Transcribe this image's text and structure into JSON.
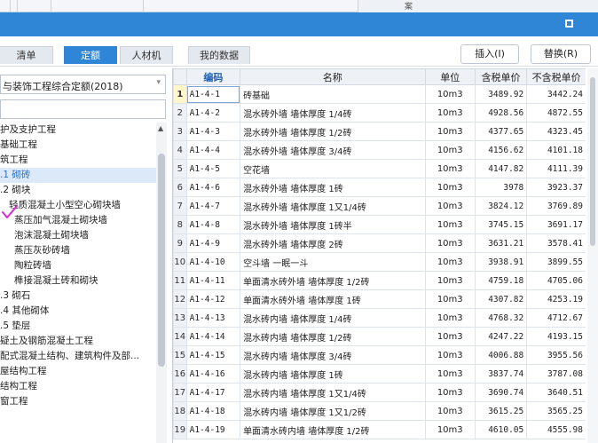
{
  "top_strip": {
    "glyph": "案"
  },
  "title_bar": {
    "maximize_label": "maximize-icon"
  },
  "tabs": [
    {
      "label": "清单",
      "active": false
    },
    {
      "label": "定额",
      "active": true
    },
    {
      "label": "人材机",
      "active": false
    },
    {
      "label": "我的数据",
      "active": false
    }
  ],
  "buttons": {
    "insert": "插入(I)",
    "replace": "替换(R)"
  },
  "left_panel": {
    "norm_select_value": "与装饰工程综合定额(2018)",
    "search_value": "",
    "tree": [
      {
        "label": "护及支护工程",
        "selected": false
      },
      {
        "label": "基础工程",
        "selected": false
      },
      {
        "label": "筑工程",
        "selected": false
      },
      {
        "label": ".1 砌砖",
        "selected": true
      },
      {
        "label": ".2 砌块",
        "selected": false
      },
      {
        "label": "轻质混凝土小型空心砌块墙",
        "selected": false
      },
      {
        "label": "蒸压加气混凝土砌块墙",
        "selected": false
      },
      {
        "label": "泡沫混凝土砌块墙",
        "selected": false
      },
      {
        "label": "蒸压灰砂砖墙",
        "selected": false
      },
      {
        "label": "陶粒砖墙",
        "selected": false
      },
      {
        "label": "榫接混凝土砖和砌块",
        "selected": false
      },
      {
        "label": ".3 砌石",
        "selected": false
      },
      {
        "label": ".4 其他砌体",
        "selected": false
      },
      {
        "label": ".5 垫层",
        "selected": false
      },
      {
        "label": "疑土及钢筋混凝土工程",
        "selected": false
      },
      {
        "label": "配式混凝土结构、建筑构件及部...",
        "selected": false
      },
      {
        "label": "屋结构工程",
        "selected": false
      },
      {
        "label": "结构工程",
        "selected": false
      },
      {
        "label": "窗工程",
        "selected": false
      }
    ]
  },
  "grid": {
    "headers": {
      "code": "编码",
      "name": "名称",
      "unit": "单位",
      "price_tax": "含税单价",
      "price_notax": "不含税单价"
    },
    "rows": [
      {
        "n": "1",
        "code": "A1-4-1",
        "name": "砖基础",
        "unit": "10m3",
        "price_tax": "3489.92",
        "price_notax": "3442.24"
      },
      {
        "n": "2",
        "code": "A1-4-2",
        "name": "混水砖外墙 墙体厚度 1/4砖",
        "unit": "10m3",
        "price_tax": "4928.56",
        "price_notax": "4872.55"
      },
      {
        "n": "3",
        "code": "A1-4-3",
        "name": "混水砖外墙 墙体厚度 1/2砖",
        "unit": "10m3",
        "price_tax": "4377.65",
        "price_notax": "4323.45"
      },
      {
        "n": "4",
        "code": "A1-4-4",
        "name": "混水砖外墙 墙体厚度 3/4砖",
        "unit": "10m3",
        "price_tax": "4156.62",
        "price_notax": "4101.18"
      },
      {
        "n": "5",
        "code": "A1-4-5",
        "name": "空花墙",
        "unit": "10m3",
        "price_tax": "4147.82",
        "price_notax": "4111.39"
      },
      {
        "n": "6",
        "code": "A1-4-6",
        "name": "混水砖外墙 墙体厚度 1砖",
        "unit": "10m3",
        "price_tax": "3978",
        "price_notax": "3923.37"
      },
      {
        "n": "7",
        "code": "A1-4-7",
        "name": "混水砖外墙 墙体厚度 1又1/4砖",
        "unit": "10m3",
        "price_tax": "3824.12",
        "price_notax": "3769.89"
      },
      {
        "n": "8",
        "code": "A1-4-8",
        "name": "混水砖外墙 墙体厚度 1砖半",
        "unit": "10m3",
        "price_tax": "3745.15",
        "price_notax": "3691.17"
      },
      {
        "n": "9",
        "code": "A1-4-9",
        "name": "混水砖外墙 墙体厚度 2砖",
        "unit": "10m3",
        "price_tax": "3631.21",
        "price_notax": "3578.41"
      },
      {
        "n": "10",
        "code": "A1-4-10",
        "name": "空斗墙 一眠一斗",
        "unit": "10m3",
        "price_tax": "3938.91",
        "price_notax": "3899.55"
      },
      {
        "n": "11",
        "code": "A1-4-11",
        "name": "单面清水砖外墙 墙体厚度 1/2砖",
        "unit": "10m3",
        "price_tax": "4759.18",
        "price_notax": "4705.06"
      },
      {
        "n": "12",
        "code": "A1-4-12",
        "name": "单面清水砖外墙 墙体厚度 1砖",
        "unit": "10m3",
        "price_tax": "4307.82",
        "price_notax": "4253.19"
      },
      {
        "n": "13",
        "code": "A1-4-13",
        "name": "混水砖内墙 墙体厚度 1/4砖",
        "unit": "10m3",
        "price_tax": "4768.32",
        "price_notax": "4712.67"
      },
      {
        "n": "14",
        "code": "A1-4-14",
        "name": "混水砖内墙 墙体厚度 1/2砖",
        "unit": "10m3",
        "price_tax": "4247.22",
        "price_notax": "4193.15"
      },
      {
        "n": "15",
        "code": "A1-4-15",
        "name": "混水砖内墙 墙体厚度 3/4砖",
        "unit": "10m3",
        "price_tax": "4006.88",
        "price_notax": "3955.56"
      },
      {
        "n": "16",
        "code": "A1-4-16",
        "name": "混水砖内墙 墙体厚度 1砖",
        "unit": "10m3",
        "price_tax": "3837.74",
        "price_notax": "3787.08"
      },
      {
        "n": "17",
        "code": "A1-4-17",
        "name": "混水砖内墙 墙体厚度 1又1/4砖",
        "unit": "10m3",
        "price_tax": "3690.74",
        "price_notax": "3640.51"
      },
      {
        "n": "18",
        "code": "A1-4-18",
        "name": "混水砖内墙 墙体厚度 1又1/2砖",
        "unit": "10m3",
        "price_tax": "3615.25",
        "price_notax": "3565.25"
      },
      {
        "n": "19",
        "code": "A1-4-19",
        "name": "单面清水砖内墙 墙体厚度 1/2砖",
        "unit": "10m3",
        "price_tax": "4610.05",
        "price_notax": "4555.98"
      }
    ]
  },
  "colors": {
    "accent": "#2f86d6",
    "selected_tree_bg": "#dce9f8",
    "annotation_check": "#d92bd0"
  }
}
